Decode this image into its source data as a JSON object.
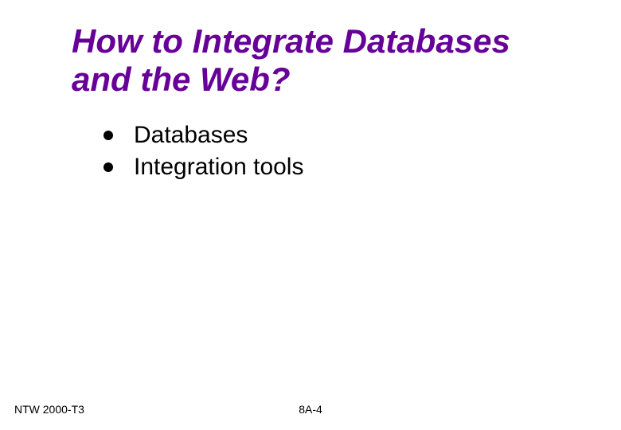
{
  "title": "How to Integrate Databases and the Web?",
  "bullets": [
    "Databases",
    "Integration tools"
  ],
  "footer": {
    "left": "NTW 2000-T3",
    "center": "8A-4"
  }
}
